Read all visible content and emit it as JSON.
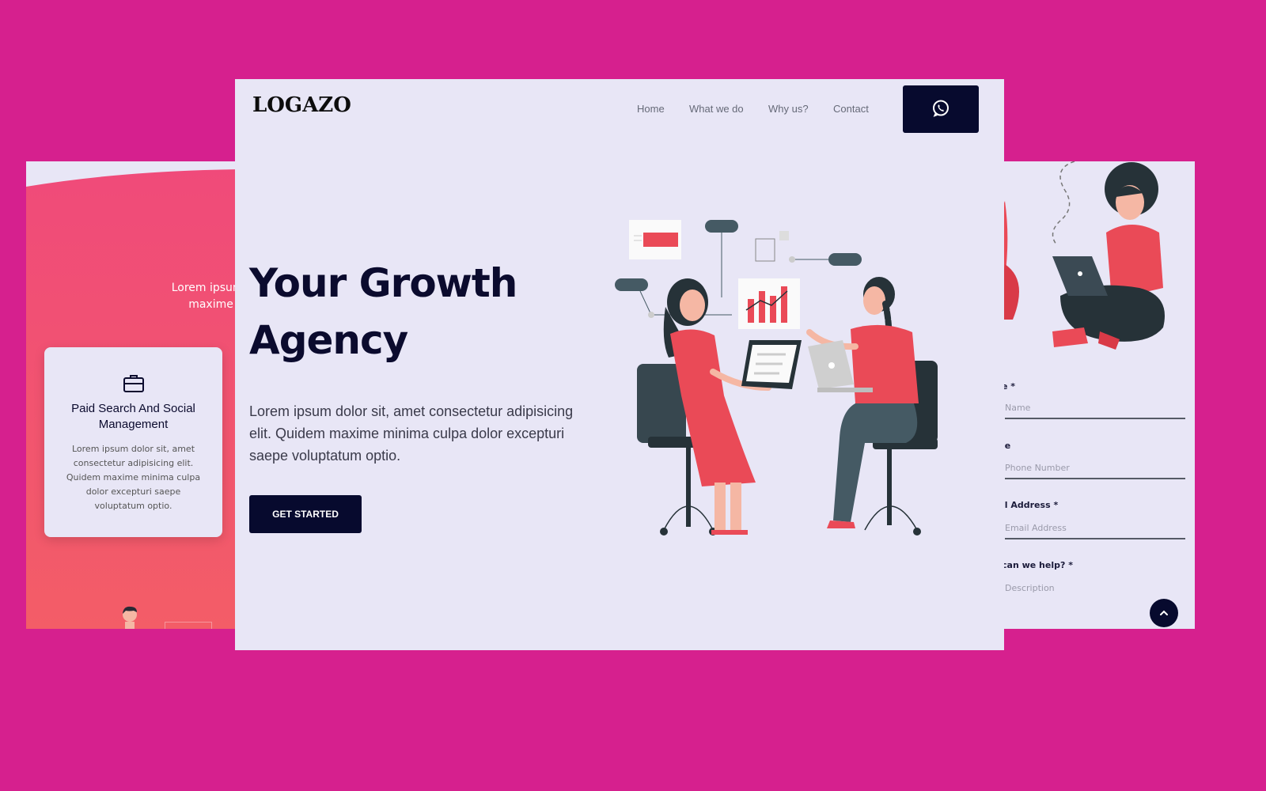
{
  "background_color": "#d6208e",
  "left_panel": {
    "intro_text": "Lorem ipsum dolor sit, maxime minima",
    "service_card": {
      "icon": "briefcase-icon",
      "title": "Paid Search And Social Management",
      "description": "Lorem ipsum dolor sit, amet consectetur adipisicing elit. Quidem maxime minima culpa dolor excepturi saepe voluptatum optio."
    }
  },
  "main_panel": {
    "logo": "LOGAZO",
    "nav": [
      "Home",
      "What we do",
      "Why us?",
      "Contact"
    ],
    "whatsapp_icon": "whatsapp-icon",
    "hero": {
      "title": "Your Growth Agency",
      "text": "Lorem ipsum dolor sit, amet consectetur adipisicing elit. Quidem maxime minima culpa dolor excepturi saepe voluptatum optio.",
      "cta": "GET STARTED"
    },
    "accent_color": "#070a2e",
    "illustration_accent": "#ea4a57"
  },
  "right_panel": {
    "form": {
      "name_label": "e *",
      "name_placeholder": "Name",
      "phone_label": "ie",
      "phone_placeholder": "Phone Number",
      "email_label": "il Address *",
      "email_placeholder": "Email Address",
      "help_label": "can we help? *",
      "help_placeholder": "Description"
    },
    "scroll_top_icon": "chevron-up-icon"
  }
}
